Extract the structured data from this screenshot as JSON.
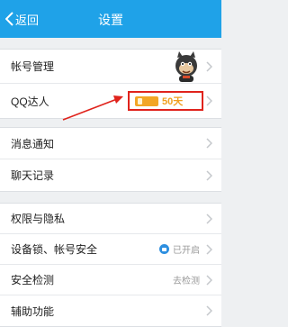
{
  "header": {
    "back_label": "返回",
    "title": "设置",
    "background_color": "#1fa2e8"
  },
  "account": {
    "account_manage_label": "帐号管理",
    "avatar_icon": "mascot-avatar-icon",
    "qq_talent_label": "QQ达人",
    "qq_talent_days": "50天",
    "qq_talent_badge_icon": "qq-talent-card-icon",
    "highlight_color": "#e0231c"
  },
  "notify": {
    "message_label": "消息通知",
    "chat_label": "聊天记录"
  },
  "security": {
    "privacy_label": "权限与隐私",
    "device_lock_label": "设备锁、帐号安全",
    "device_lock_status": "已开启",
    "device_lock_icon": "lock-icon",
    "security_check_label": "安全检测",
    "security_check_status": "去检测",
    "help_label": "辅助功能"
  }
}
